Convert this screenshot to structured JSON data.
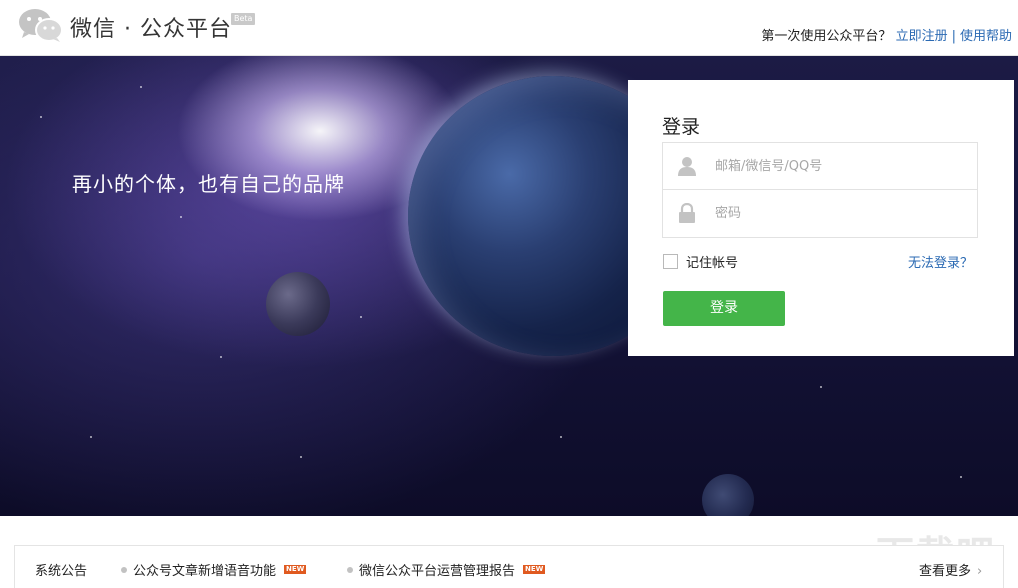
{
  "header": {
    "brand": "微信 · 公众平台",
    "beta": "Beta",
    "first_time": "第一次使用公众平台？",
    "register": "立即注册",
    "separator": "|",
    "help": "使用帮助"
  },
  "banner": {
    "slogan": "再小的个体，也有自己的品牌"
  },
  "login": {
    "title": "登录",
    "username_placeholder": "邮箱/微信号/QQ号",
    "username_value": "",
    "password_placeholder": "密码",
    "password_value": "",
    "remember_label": "记住帐号",
    "remember_checked": false,
    "forgot": "无法登录？",
    "submit": "登录",
    "submit_color": "#44b549"
  },
  "notice": {
    "title": "系统公告",
    "items": [
      {
        "text": "公众号文章新增语音功能",
        "badge": "NEW"
      },
      {
        "text": "微信公众平台运营管理报告",
        "badge": "NEW"
      }
    ],
    "more": "查看更多",
    "more_arrow": "›"
  },
  "watermark": "下载吧",
  "colors": {
    "link": "#2b6ab3",
    "accent_green": "#44b549",
    "badge_red": "#e05a20"
  },
  "icons": {
    "logo": "wechat-logo-icon",
    "username": "user-icon",
    "password": "lock-icon"
  }
}
